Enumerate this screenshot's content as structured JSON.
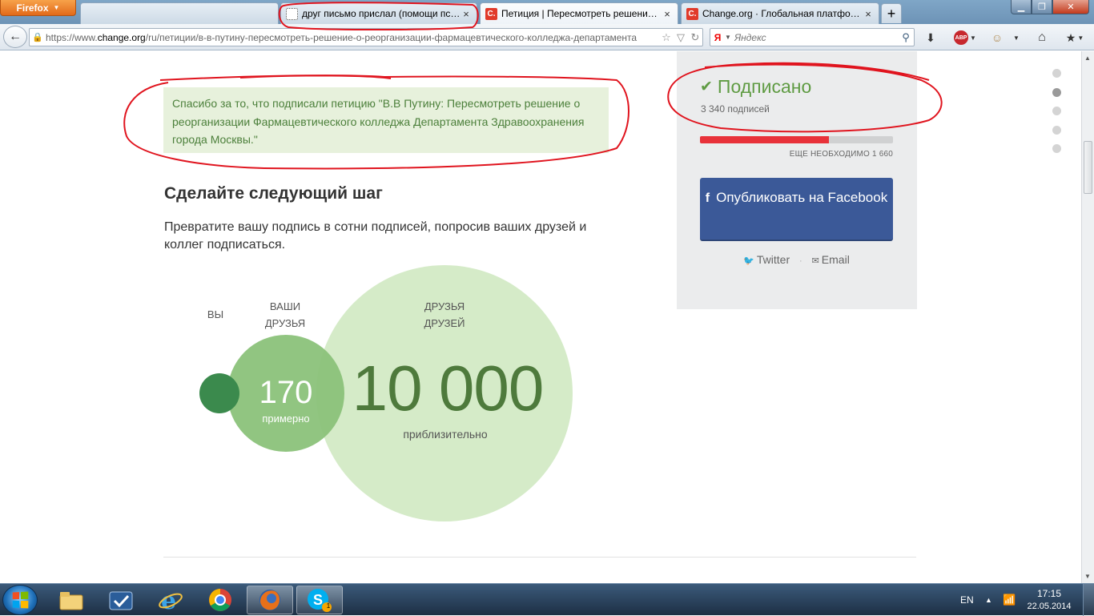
{
  "browser": {
    "menu_button": "Firefox",
    "tabs": [
      {
        "label": "",
        "favicon": "blank"
      },
      {
        "label": "друг письмо прислал (помощи пст...",
        "favicon": "blank"
      },
      {
        "label": "Петиция | Пересмотреть решение о...",
        "favicon": "change-org"
      },
      {
        "label": "Change.org · Глобальная платформ...",
        "favicon": "change-org"
      }
    ],
    "new_tab": "+",
    "url_prefix": "https://www.",
    "url_domain": "change.org",
    "url_path": "/ru/петиции/в-в-путину-пересмотреть-решение-о-реорганизации-фармацевтического-колледжа-департамента",
    "search_engine": "Я",
    "search_placeholder": "Яндекс",
    "abp_label": "ABP"
  },
  "petition": {
    "thanks_message": "Спасибо за то, что подписали петицию \"В.В Путину: Пересмотреть решение о реорганизации Фармацевтического колледжа Департамента Здравоохранения города Москвы.\"",
    "next_step_title": "Сделайте следующий шаг",
    "next_step_desc": "Превратите вашу подпись в сотни подписей, попросив ваших друзей и коллег подписаться.",
    "circles": {
      "you_label": "ВЫ",
      "friends_label_1": "ВАШИ",
      "friends_label_2": "ДРУЗЬЯ",
      "fof_label_1": "ДРУЗЬЯ",
      "fof_label_2": "ДРУЗЕЙ",
      "friends_count": "170",
      "friends_sub": "примерно",
      "fof_count": "10 000",
      "fof_sub": "приблизительно"
    }
  },
  "sidebar": {
    "signed_label": "Подписано",
    "signature_count": "3 340 подписей",
    "progress_fraction": 0.668,
    "needed_text": "ЕЩЕ НЕОБХОДИМО 1 660",
    "facebook_button": "Опубликовать на Facebook",
    "twitter_link": "Twitter",
    "email_link": "Email",
    "separator": "·"
  },
  "nav_dots": {
    "count": 5,
    "active_index": 1
  },
  "taskbar": {
    "language": "EN",
    "time": "17:15",
    "date": "22.05.2014",
    "skype_badge": "1"
  },
  "colors": {
    "annotation": "#e0141e",
    "signed_green": "#5f9b43",
    "facebook_blue": "#3b5998",
    "progress_red": "#e8323a"
  },
  "icons": [
    "back-arrow-icon",
    "lock-icon",
    "star-icon",
    "dropdown-icon",
    "reload-icon",
    "search-icon",
    "download-icon",
    "addon-face-icon",
    "home-icon",
    "bookmarks-icon",
    "check-icon",
    "facebook-icon",
    "twitter-icon",
    "email-icon"
  ]
}
